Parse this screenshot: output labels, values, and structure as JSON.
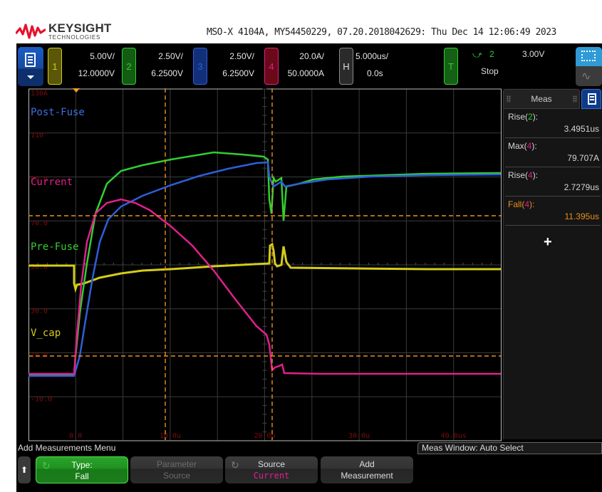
{
  "header": {
    "brand": "KEYSIGHT",
    "brand_sub": "TECHNOLOGIES",
    "instrument_line": "MSO-X 4104A, MY54450229, 07.20.2018042629: Thu Dec 14 12:06:49 2023"
  },
  "channels": [
    {
      "num": "1",
      "scale": "5.00V/",
      "offset": "12.0000V",
      "color": "#d4cc1a"
    },
    {
      "num": "2",
      "scale": "2.50V/",
      "offset": "6.2500V",
      "color": "#32cd32"
    },
    {
      "num": "3",
      "scale": "2.50V/",
      "offset": "6.2500V",
      "color": "#2e5fd8"
    },
    {
      "num": "4",
      "scale": "20.0A/",
      "offset": "50.0000A",
      "color": "#e0208c"
    }
  ],
  "horizontal": {
    "label": "H",
    "scale": "5.000us/",
    "delay": "0.0s"
  },
  "trigger": {
    "label": "T",
    "slope_icon": "rising-edge",
    "source": "2",
    "level": "3.00V",
    "state": "Stop"
  },
  "waveform": {
    "labels": {
      "ch3": "Post-Fuse",
      "ch4": "Current",
      "ch2": "Pre-Fuse",
      "ch1": "V_cap"
    },
    "y_ticks": [
      "130A",
      "110",
      "90.0",
      "70.0",
      "50.0",
      "30.0",
      "10.0",
      "-10.0"
    ],
    "x_ticks": [
      "0.0",
      "10.0u",
      "20.0u",
      "30.0u",
      "40.0us"
    ],
    "ground_marker": "4"
  },
  "meas_panel": {
    "tab_label": "Meas",
    "rows": [
      {
        "name": "Rise",
        "ch": "2",
        "value": "3.4951us",
        "selected": false
      },
      {
        "name": "Max",
        "ch": "4",
        "value": "79.707A",
        "selected": false
      },
      {
        "name": "Rise",
        "ch": "4",
        "value": "2.7279us",
        "selected": false
      },
      {
        "name": "Fall",
        "ch": "4",
        "value": "11.395us",
        "selected": true
      }
    ],
    "add_label": "+"
  },
  "softkeys": {
    "menu_title": "Add Measurements Menu",
    "meas_window": "Meas Window: Auto Select",
    "type_label": "Type:",
    "type_value": "Fall",
    "param_label": "Parameter",
    "param_value": "Source",
    "source_label": "Source",
    "source_value": "Current",
    "add_label": "Add",
    "add_value": "Measurement"
  }
}
